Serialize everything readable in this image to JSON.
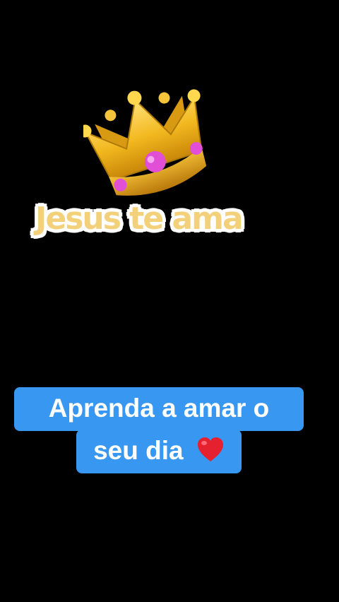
{
  "sticker": {
    "icon": "crown-icon",
    "text": "Jesus te ama",
    "text_color": "#f3d07a"
  },
  "caption": {
    "line1": "Aprenda a amar o",
    "line2": "seu dia",
    "emoji": "red-heart-icon",
    "bg_color": "#3897f0",
    "text_color": "#ffffff"
  },
  "background_color": "#000000"
}
